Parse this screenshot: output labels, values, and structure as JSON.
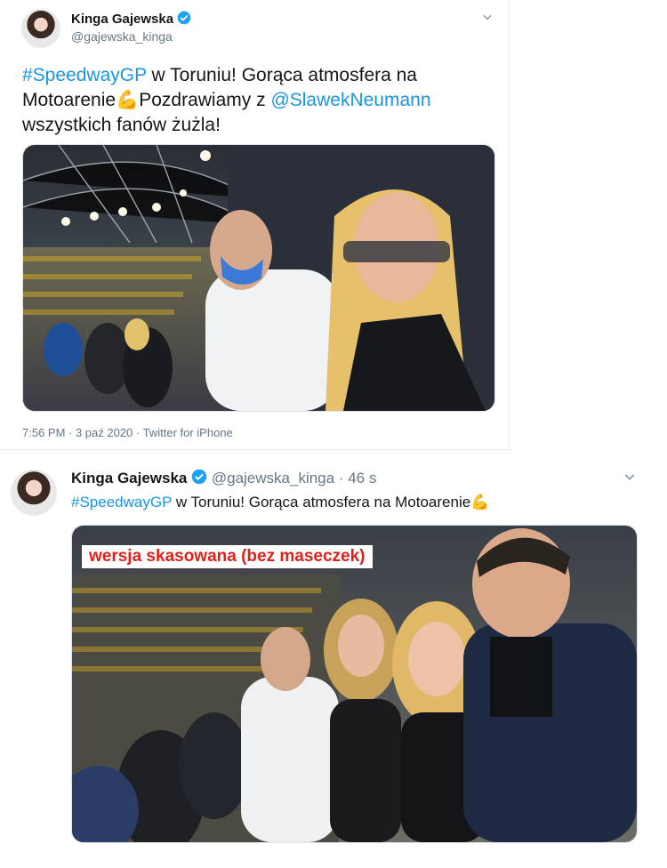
{
  "tweet1": {
    "author_name": "Kinga Gajewska",
    "handle": "@gajewska_kinga",
    "hashtag": "#SpeedwayGP",
    "text_part1": " w Toruniu! Gorąca atmosfera na",
    "text_part2": "Motoarenie",
    "emoji": "💪",
    "text_part3": "Pozdrawiamy z ",
    "mention": "@SlawekNeumann",
    "text_part4": "wszystkich fanów żużla!",
    "meta": "7:56 PM · 3 paź 2020 · Twitter for iPhone"
  },
  "tweet2": {
    "author_name": "Kinga Gajewska",
    "handle": "@gajewska_kinga",
    "time": "· 46 s",
    "hashtag": "#SpeedwayGP",
    "text": " w Toruniu! Gorąca atmosfera na Motoarenie",
    "emoji": "💪",
    "overlay_label": "wersja skasowana (bez maseczek)"
  },
  "icons": {
    "verified": "verified-badge-icon",
    "chevron": "chevron-down-icon"
  },
  "colors": {
    "link": "#1b95e0",
    "overlay_text": "#e0201b",
    "verified": "#1da1f2"
  }
}
